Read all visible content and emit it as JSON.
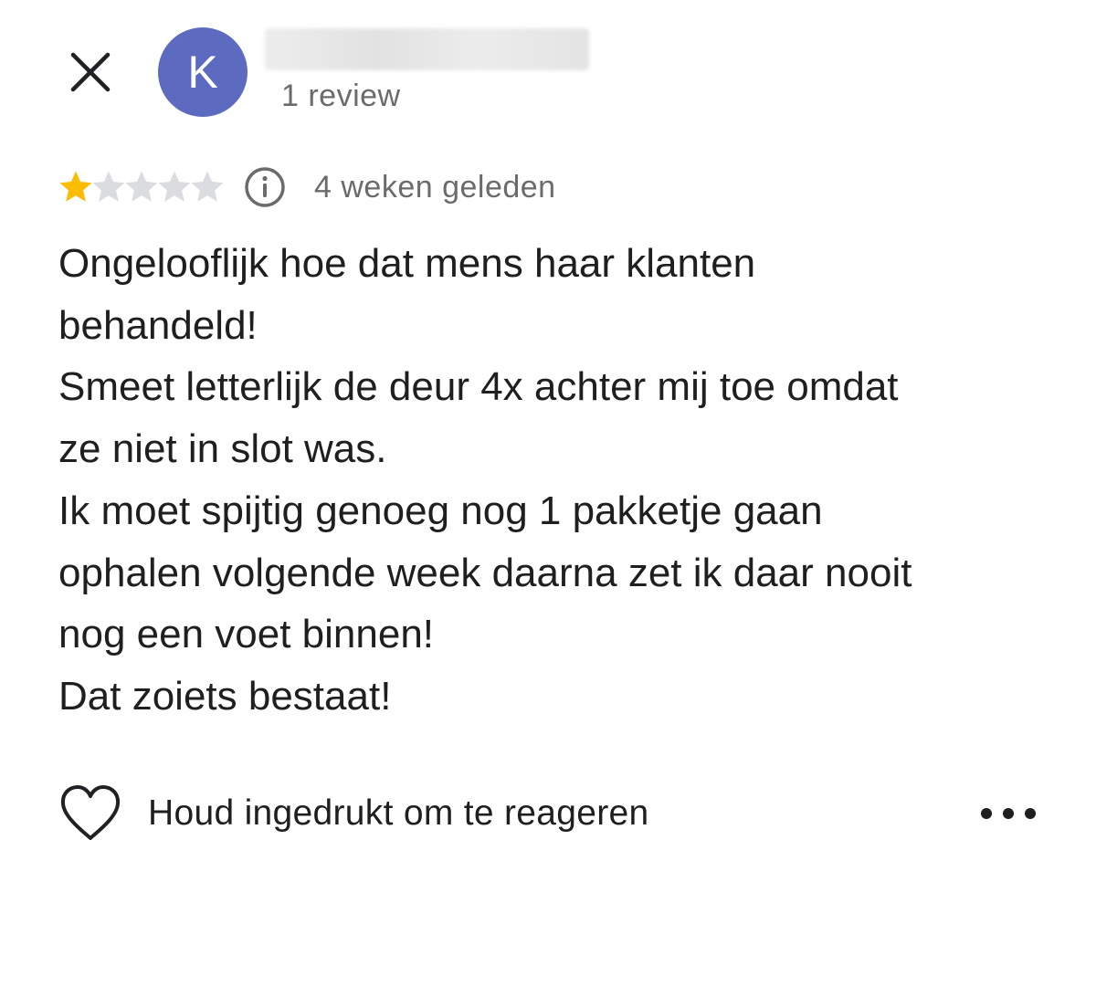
{
  "header": {
    "close_icon": "close-icon",
    "avatar_letter": "K",
    "avatar_color": "#5c6bc0",
    "author_name": "",
    "review_count": "1 review"
  },
  "rating": {
    "stars": 1,
    "max_stars": 5,
    "star_color": "#fbbc04",
    "empty_star_color": "#dadce0",
    "info_icon": "info-icon",
    "date": "4 weken geleden"
  },
  "review": {
    "lines": [
      "Ongelooflijk hoe dat mens haar klanten",
      "behandeld!",
      "Smeet letterlijk de deur 4x achter mij toe omdat",
      "ze niet in slot was.",
      "Ik moet spijtig genoeg nog 1 pakketje gaan",
      "ophalen volgende week daarna zet ik daar nooit",
      "nog een voet binnen!",
      "Dat zoiets bestaat!"
    ]
  },
  "actions": {
    "heart_icon": "heart-icon",
    "react_label": "Houd ingedrukt om te reageren",
    "more_icon": "more-horizontal-icon"
  }
}
